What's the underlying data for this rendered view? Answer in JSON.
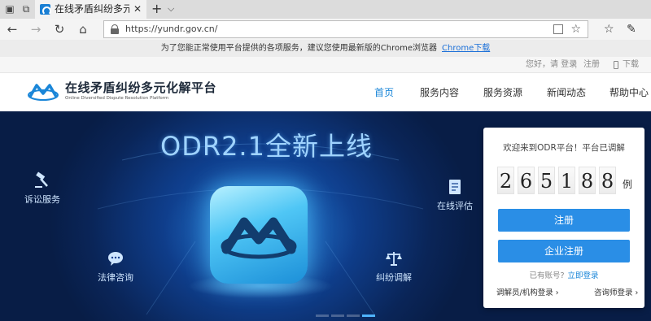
{
  "browser": {
    "tab_title": "在线矛盾纠纷多元化解平",
    "url": "https://yundr.gov.cn/",
    "new_tab_symbol": "+",
    "tab_close_symbol": "✕",
    "tab_menu_symbol": "⌵",
    "back_symbol": "←",
    "forward_symbol": "→",
    "refresh_symbol": "↻",
    "home_symbol": "⌂",
    "favorite_symbol": "☆",
    "favorites_hub_symbol": "☆",
    "pen_symbol": "✎"
  },
  "notice": {
    "text": "为了您能正常使用平台提供的各项服务，建议您使用最新版的Chrome浏览器",
    "link": "Chrome下载"
  },
  "utilbar": {
    "greeting": "您好，请 登录",
    "separator": "|",
    "register": "注册",
    "download_app": "下载APP"
  },
  "header": {
    "title": "在线矛盾纠纷多元化解平台",
    "subtitle": "Online Diversified Dispute Resolution Platform",
    "nav": [
      {
        "label": "首页",
        "active": true
      },
      {
        "label": "服务内容",
        "active": false
      },
      {
        "label": "服务资源",
        "active": false
      },
      {
        "label": "新闻动态",
        "active": false
      },
      {
        "label": "帮助中心",
        "active": false
      }
    ]
  },
  "banner": {
    "headline": "ODR2.1全新上线",
    "features": {
      "litigation": "诉讼服务",
      "legal_consult": "法律咨询",
      "online_eval": "在线评估",
      "dispute_mediation": "纠纷调解"
    },
    "slide_count": 4,
    "active_slide": 4
  },
  "login_card": {
    "welcome": "欢迎来到ODR平台！平台已调解",
    "counter_digits": [
      "2",
      "6",
      "5",
      "1",
      "8",
      "8"
    ],
    "counter_unit": "例",
    "register_button": "注册",
    "enterprise_register_button": "企业注册",
    "has_account": "已有账号?",
    "login_now": "立即登录",
    "mediator_login": "调解员/机构登录 ›",
    "counselor_login": "咨询师登录 ›"
  },
  "colors": {
    "accent": "#1a86d8",
    "button": "#2a8ee6",
    "banner_dark": "#0a2558"
  }
}
